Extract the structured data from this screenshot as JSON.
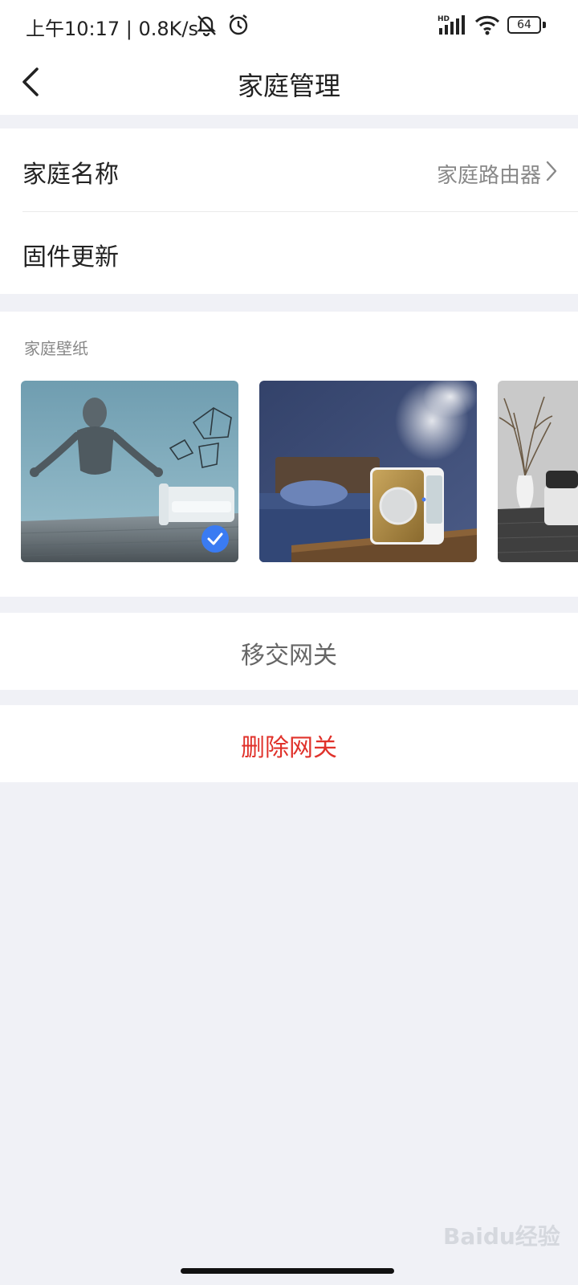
{
  "status_bar": {
    "time": "上午10:17 | 0.8K/s",
    "battery_level": "64",
    "icons": [
      "mute-bell-icon",
      "alarm-icon",
      "hd-signal-icon",
      "wifi-icon",
      "battery-icon"
    ]
  },
  "header": {
    "title": "家庭管理",
    "back_icon": "chevron-left-icon"
  },
  "settings": {
    "family_name_label": "家庭名称",
    "family_name_value": "家庭路由器",
    "firmware_label": "固件更新"
  },
  "wallpaper": {
    "section_label": "家庭壁纸",
    "selected_index": 0,
    "items": [
      {
        "name": "sculpture-room-wallpaper",
        "selected": true
      },
      {
        "name": "humidifier-bedroom-wallpaper",
        "selected": false
      },
      {
        "name": "grey-living-room-wallpaper",
        "selected": false
      }
    ]
  },
  "actions": {
    "transfer_label": "移交网关",
    "delete_label": "删除网关"
  },
  "watermark": "Baidu经验",
  "colors": {
    "page_background": "#f0f1f6",
    "card_background": "#ffffff",
    "danger": "#e0322b",
    "selected_check": "#3a7bf2",
    "muted_text": "#888888"
  }
}
